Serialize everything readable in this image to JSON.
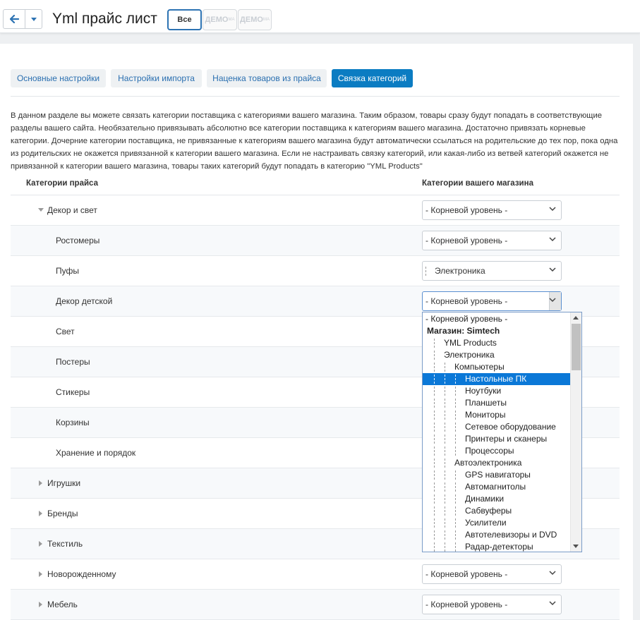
{
  "header": {
    "title": "Yml прайс лист",
    "lang_all": "Все",
    "lang_demo1": "ДЕМО",
    "lang_demo1_sup": "MA",
    "lang_demo2": "ДЕМО",
    "lang_demo2_sup": "MA"
  },
  "tabs": [
    {
      "label": "Основные настройки",
      "active": false
    },
    {
      "label": "Настройки импорта",
      "active": false
    },
    {
      "label": "Наценка товаров из прайса",
      "active": false
    },
    {
      "label": "Связка категорий",
      "active": true
    }
  ],
  "description": "В данном разделе вы можете связать категории поставщика с категориями вашего магазина. Таким образом, товары сразу будут попадать в соответствующие разделы вашего сайта. Необязательно привязывать абсолютно все категории поставщика к категориям вашего магазина. Достаточно привязать корневые категории. Дочерние категории поставщика, не привязанные к категориям вашего магазина будут автоматически ссылаться на родительские до тех пор, пока одна из родительских не окажется привязанной к категории вашего магазина. Если не настраивать связку категорий, или какая-либо из ветвей категорий окажется не привязанной к категории вашего магазина, товары таких категорий будут попадать в категорию \"YML Products\"",
  "table": {
    "col_price": "Категории прайса",
    "col_store": "Категории вашего магазина",
    "rows": [
      {
        "label": "Декор и свет",
        "select": "- Корневой уровень -"
      },
      {
        "label": "Ростомеры",
        "select": "- Корневой уровень -"
      },
      {
        "label": "Пуфы",
        "select": "Электроника"
      },
      {
        "label": "Декор детской",
        "select": "- Корневой уровень -"
      },
      {
        "label": "Свет",
        "select": ""
      },
      {
        "label": "Постеры",
        "select": ""
      },
      {
        "label": "Стикеры",
        "select": ""
      },
      {
        "label": "Корзины",
        "select": ""
      },
      {
        "label": "Хранение и порядок",
        "select": ""
      },
      {
        "label": "Игрушки",
        "select": ""
      },
      {
        "label": "Бренды",
        "select": ""
      },
      {
        "label": "Текстиль",
        "select": ""
      },
      {
        "label": "Новорожденному",
        "select": "- Корневой уровень -"
      },
      {
        "label": "Мебель",
        "select": "- Корневой уровень -"
      }
    ]
  },
  "dropdown": {
    "items": [
      {
        "label": "- Корневой уровень -"
      },
      {
        "label": "Магазин: Simtech"
      },
      {
        "label": "YML Products"
      },
      {
        "label": "Электроника"
      },
      {
        "label": "Компьютеры"
      },
      {
        "label": "Настольные ПК"
      },
      {
        "label": "Ноутбуки"
      },
      {
        "label": "Планшеты"
      },
      {
        "label": "Мониторы"
      },
      {
        "label": "Сетевое оборудование"
      },
      {
        "label": "Принтеры и сканеры"
      },
      {
        "label": "Процессоры"
      },
      {
        "label": "Автоэлектроника"
      },
      {
        "label": "GPS навигаторы"
      },
      {
        "label": "Автомагнитолы"
      },
      {
        "label": "Динамики"
      },
      {
        "label": "Сабвуферы"
      },
      {
        "label": "Усилители"
      },
      {
        "label": "Автотелевизоры и DVD"
      },
      {
        "label": "Радар-детекторы"
      }
    ]
  },
  "colors": {
    "accent": "#0b7cc2",
    "selected": "#0b78d7",
    "link": "#2a6fb0"
  }
}
